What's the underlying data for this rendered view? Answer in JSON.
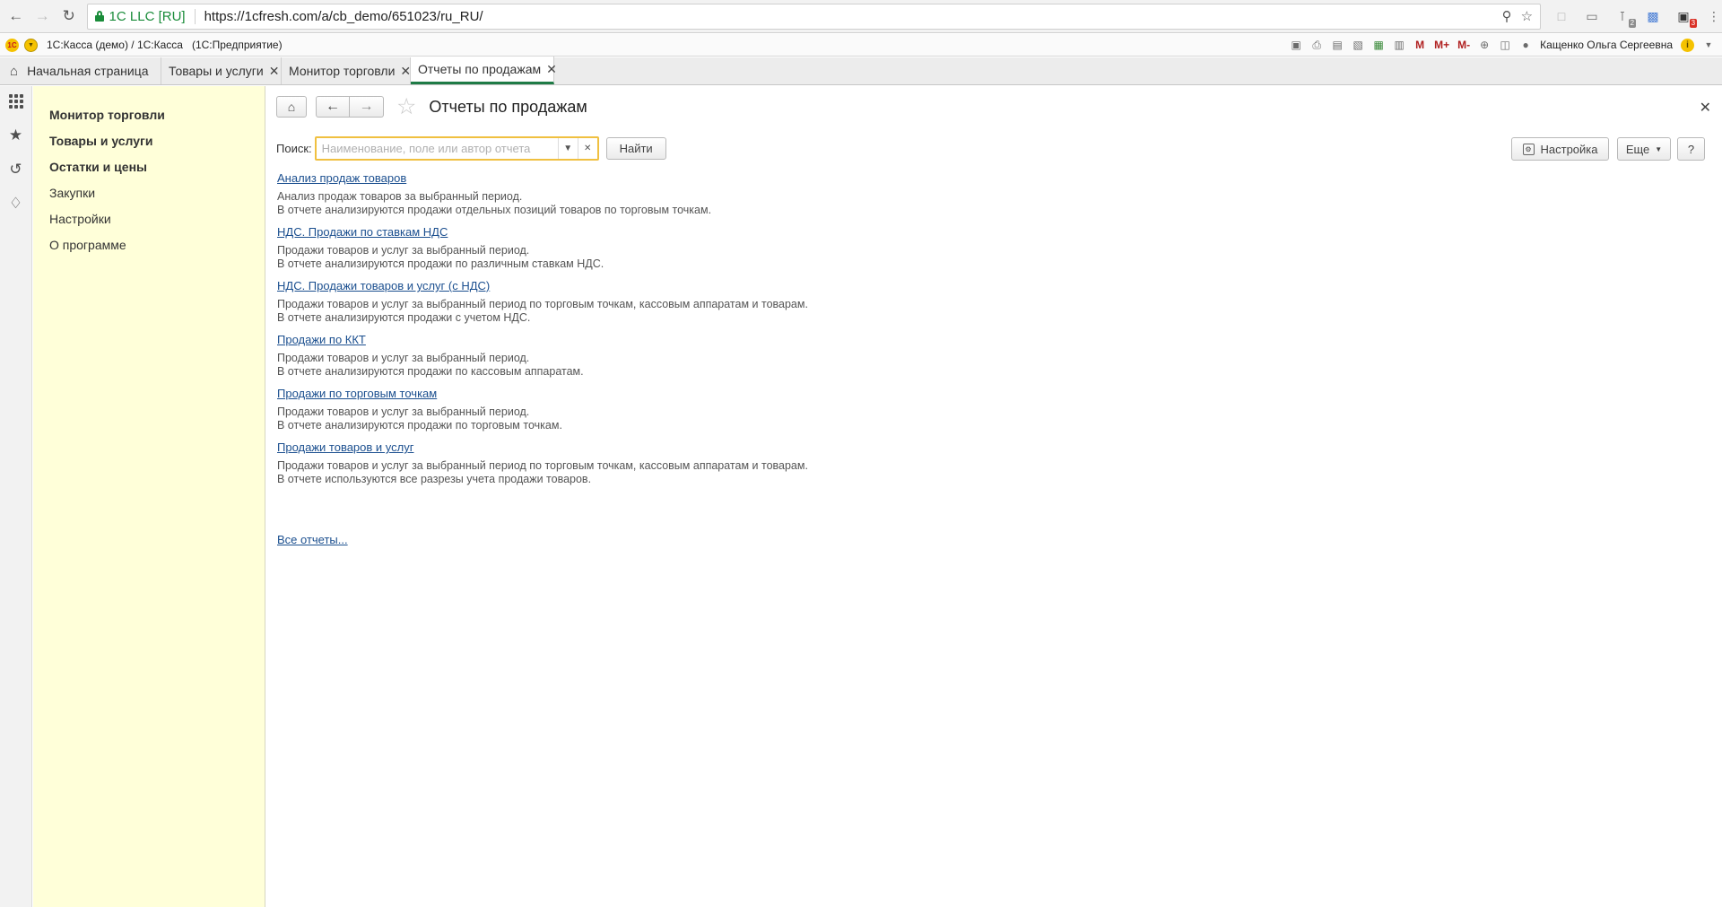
{
  "browser": {
    "site_identity": "1C LLC [RU]",
    "url": "https://1cfresh.com/a/cb_demo/651023/ru_RU/",
    "ext_badge_gray": "2",
    "ext_badge_red": "3"
  },
  "app": {
    "logo_text": "1C",
    "title": "1С:Касса (демо) / 1С:Касса   (1С:Предприятие)",
    "user": "Кащенко Ольга Сергеевна",
    "tools": {
      "m": "M",
      "m_plus": "M+",
      "m_minus": "M-"
    }
  },
  "tabs": [
    {
      "label": "Начальная страница"
    },
    {
      "label": "Товары и услуги"
    },
    {
      "label": "Монитор торговли"
    },
    {
      "label": "Отчеты по продажам"
    }
  ],
  "sections": [
    {
      "label": "Монитор торговли"
    },
    {
      "label": "Товары и услуги"
    },
    {
      "label": "Остатки и цены"
    },
    {
      "label": "Закупки"
    },
    {
      "label": "Настройки"
    },
    {
      "label": "О программе"
    }
  ],
  "form": {
    "title": "Отчеты по продажам",
    "search_label": "Поиск:",
    "search_value": "",
    "search_placeholder": "Наименование, поле или автор отчета",
    "find_label": "Найти",
    "settings_label": "Настройка",
    "more_label": "Еще",
    "help_label": "?",
    "all_reports": "Все отчеты..."
  },
  "reports": [
    {
      "title": "Анализ продаж товаров",
      "line1": "Анализ продаж товаров за выбранный период.",
      "line2": "В отчете анализируются продажи отдельных позиций товаров по торговым точкам."
    },
    {
      "title": "НДС. Продажи по ставкам НДС",
      "line1": "Продажи товаров и услуг за выбранный период.",
      "line2": "В отчете анализируются продажи по различным ставкам НДС."
    },
    {
      "title": "НДС. Продажи товаров и услуг (с НДС)",
      "line1": "Продажи товаров и услуг за выбранный период по торговым точкам, кассовым аппаратам и товарам.",
      "line2": "В отчете анализируются продажи с учетом НДС."
    },
    {
      "title": "Продажи по ККТ",
      "line1": "Продажи товаров и услуг за выбранный период.",
      "line2": "В отчете анализируются продажи по кассовым аппаратам."
    },
    {
      "title": "Продажи по торговым точкам",
      "line1": "Продажи товаров и услуг за выбранный период.",
      "line2": "В отчете анализируются продажи по торговым точкам."
    },
    {
      "title": "Продажи товаров и услуг",
      "line1": "Продажи товаров и услуг за выбранный период по торговым точкам, кассовым аппаратам и товарам.",
      "line2": "В отчете используются все разрезы учета продажи товаров."
    }
  ],
  "colors": {
    "accent_green": "#1f7b46",
    "section_panel_bg": "#ffffd9",
    "link_blue": "#1b4f8f",
    "search_focus": "#f0c040",
    "brand_yellow": "#f5c200"
  }
}
